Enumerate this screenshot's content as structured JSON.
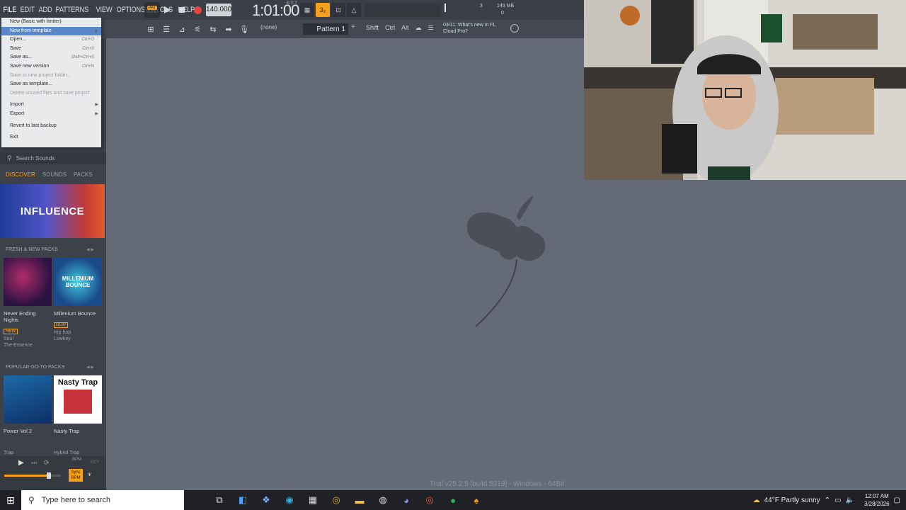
{
  "menubar": [
    "FILE",
    "EDIT",
    "ADD",
    "PATTERNS",
    "VIEW",
    "OPTIONS",
    "TOOLS",
    "HELP"
  ],
  "transport": {
    "pat_label": "PAT",
    "song_label": "SONG",
    "tempo": "140.000",
    "time": "1:01:00",
    "time_unit": "B:S:T"
  },
  "monitor": {
    "cpu": "3",
    "memory": "149 MB",
    "polyphony": "0"
  },
  "toolbar2": {
    "none_label": "(none)",
    "pattern": "Pattern 1",
    "plus": "+",
    "mod_keys": [
      "Shift",
      "Ctrl",
      "Alt"
    ],
    "news_line1": "03/11: What's new in FL",
    "news_line2": "Cloud Pro?"
  },
  "file_menu": [
    {
      "label": "New (Basic with limiter)",
      "shortcut": "",
      "state": "normal"
    },
    {
      "label": "New from template",
      "shortcut": "",
      "state": "highlight",
      "submenu": true
    },
    {
      "label": "Open...",
      "shortcut": "Ctrl+O",
      "state": "normal"
    },
    {
      "label": "Save",
      "shortcut": "Ctrl+S",
      "state": "normal"
    },
    {
      "label": "Save as...",
      "shortcut": "Shift+Ctrl+S",
      "state": "normal"
    },
    {
      "label": "Save new version",
      "shortcut": "Ctrl+N",
      "state": "normal"
    },
    {
      "label": "Save to new project folder...",
      "shortcut": "",
      "state": "disabled"
    },
    {
      "label": "Save as template...",
      "shortcut": "",
      "state": "normal"
    },
    {
      "label": "Delete unused files and save project",
      "shortcut": "",
      "state": "disabled"
    },
    {
      "label": "Import",
      "shortcut": "",
      "state": "normal",
      "submenu": true
    },
    {
      "label": "Export",
      "shortcut": "",
      "state": "normal",
      "submenu": true
    },
    {
      "label": "Revert to last backup",
      "shortcut": "",
      "state": "normal"
    },
    {
      "label": "Exit",
      "shortcut": "",
      "state": "normal"
    }
  ],
  "browser": {
    "search_placeholder": "Search Sounds",
    "tabs": [
      "DISCOVER",
      "SOUNDS",
      "PACKS"
    ],
    "banner": "INFLUENCE",
    "section1": "FRESH & NEW PACKS",
    "section2": "POPULAR GO-TO PACKS",
    "packs_fresh": [
      {
        "title": "Never Ending Nights",
        "badge": "NEW",
        "genre": "Soul",
        "artist": "The Essence"
      },
      {
        "title": "Millenium Bounce",
        "badge": "NEW",
        "genre": "Hip hop",
        "artist": "Lowkey"
      }
    ],
    "packs_popular": [
      {
        "title": "Power Vol 2",
        "genre": "Trap"
      },
      {
        "title": "Nasty Trap",
        "genre": "Hybrid Trap"
      }
    ],
    "thumb2_text": "MILLENIUM BOUNCE",
    "thumb4_text": "Nasty Trap",
    "player": {
      "bpm_label": "BPM",
      "key_label": "KEY",
      "sync_label": "Sync BPM"
    }
  },
  "footer_text": "Trial v25.2.5 [build 5319] - Windows - 64Bit",
  "taskbar": {
    "search_placeholder": "Type here to search",
    "weather": "44°F  Partly sunny",
    "time": "12:07 AM",
    "date": "3/28/2026"
  },
  "colors": {
    "accent": "#f6a01a",
    "menu_highlight": "#5a87c9",
    "record": "#e0473e"
  }
}
